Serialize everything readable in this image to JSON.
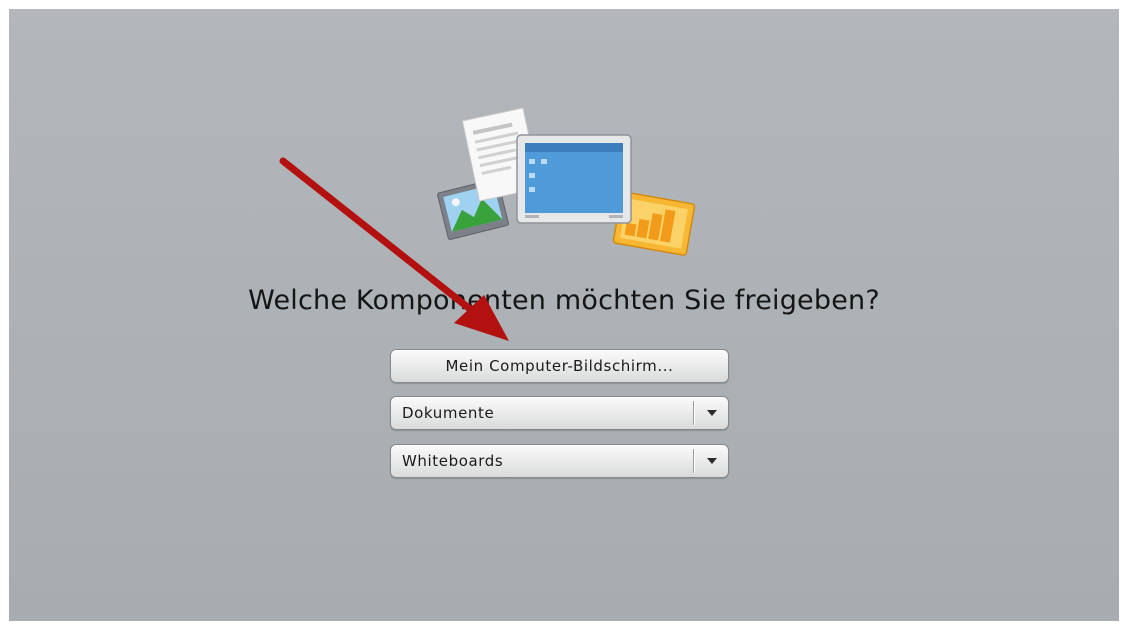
{
  "question": "Welche Komponenten möchten Sie freigeben?",
  "share_options": {
    "screen_button": "Mein Computer-Bildschirm...",
    "documents_dropdown": "Dokumente",
    "whiteboards_dropdown": "Whiteboards"
  },
  "colors": {
    "background": "#adb2b6",
    "annotation_arrow": "#b3110f"
  },
  "icons": {
    "hero": "share-content-illustration-icon",
    "dropdown_arrow": "chevron-down-icon",
    "annotation": "red-arrow-icon"
  }
}
